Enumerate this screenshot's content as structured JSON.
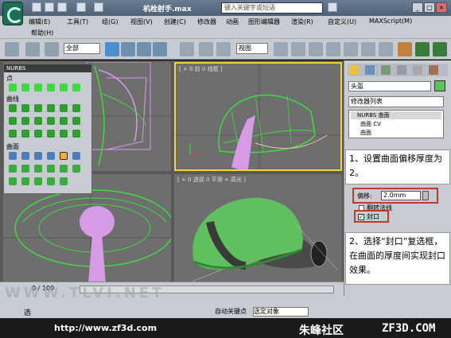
{
  "window": {
    "title": "机栓射手.max"
  },
  "search": {
    "placeholder": "键入关键字或短语"
  },
  "menu": {
    "items": [
      "编辑(E)",
      "工具(T)",
      "组(G)",
      "视图(V)",
      "创建(C)",
      "修改器",
      "动画",
      "图形编辑器",
      "渲染(R)",
      "自定义(U)",
      "MAXScript(M)"
    ],
    "help": "帮助(H)"
  },
  "toolbar": {
    "selection_filter": "全部",
    "view_ref": "视图"
  },
  "nurbs_panel": {
    "title": "NURBS",
    "sections": {
      "point": "点",
      "curve": "曲线",
      "surface": "曲面"
    }
  },
  "viewports": {
    "top_right": "[ + 0 前 0 线框 ]",
    "bottom_right": "[ + 0 透视 0 平滑 + 高光 ]"
  },
  "command_panel": {
    "object_name": "头盔",
    "modifier_list": "修改器列表",
    "stack": [
      "NURBS 曲面",
      "曲面 CV",
      "曲面"
    ],
    "offset_label": "偏移:",
    "offset_value": "2.0mm",
    "flip_label": "翻转法线",
    "cap_label": "封口"
  },
  "callouts": {
    "one": "1、设置曲面偏移厚度为 2。",
    "two": "2、选择“封口”复选框，在曲面的厚度间实现封口效果。"
  },
  "timeline": {
    "frame": "0 / 100"
  },
  "statusbar": {
    "auto_key": "自动关键点",
    "selected": "选定对象",
    "select_label": "选"
  },
  "footer": {
    "url": "http://www.zf3d.com",
    "brand": "朱峰社区",
    "brand_site": "ZF3D.COM"
  },
  "watermark": "WWW.TLVI.NET",
  "colors": {
    "highlight_red": "#c0392b",
    "viewport_active": "#f5d23c",
    "green_mesh": "#3cdc3c",
    "pink_mesh": "#d79be6"
  }
}
